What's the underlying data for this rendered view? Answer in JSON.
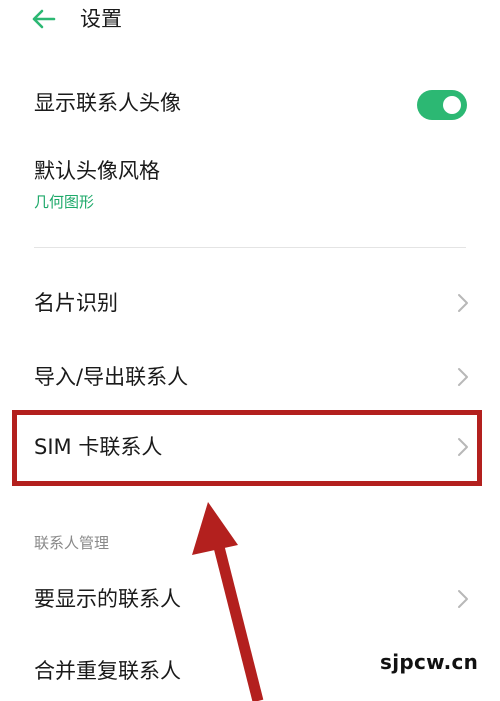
{
  "header": {
    "title": "设置",
    "back_icon": "back-arrow-icon"
  },
  "colors": {
    "accent": "#2cb873",
    "sub_text": "#1ea96a",
    "highlight": "#b3201e"
  },
  "settings": {
    "show_avatar": {
      "label": "显示联系人头像",
      "toggle_on": true
    },
    "default_avatar_style": {
      "label": "默认头像风格",
      "value": "几何图形"
    },
    "card_recognition": {
      "label": "名片识别"
    },
    "import_export": {
      "label": "导入/导出联系人"
    },
    "sim_contacts": {
      "label": "SIM 卡联系人"
    }
  },
  "contacts_management": {
    "section_title": "联系人管理",
    "contacts_to_display": {
      "label": "要显示的联系人"
    },
    "merge_duplicates": {
      "label": "合并重复联系人"
    }
  },
  "watermark": "sjpcw.cn"
}
